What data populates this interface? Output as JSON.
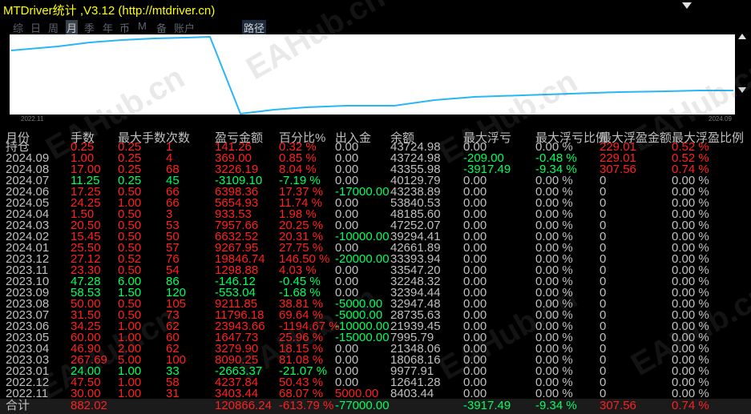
{
  "window": {
    "title": "MTDriver统计 ,V3.12 (http://mtdriver.cn)"
  },
  "tabs": [
    {
      "label": "综",
      "active": false
    },
    {
      "label": "日",
      "active": false
    },
    {
      "label": "周",
      "active": false
    },
    {
      "label": "月",
      "active": true
    },
    {
      "label": "季",
      "active": false
    },
    {
      "label": "年",
      "active": false
    },
    {
      "label": "币",
      "active": false
    },
    {
      "label": "M",
      "active": false
    },
    {
      "label": "备",
      "active": false
    },
    {
      "label": "账户",
      "active": false
    },
    {
      "label": "路径",
      "active": false
    }
  ],
  "chart": {
    "line_color": "#29b6f6",
    "start_label": "2022.11",
    "end_label": "2024.09"
  },
  "watermark": "EAHub.cn",
  "colors": {
    "red": "#ff2020",
    "green": "#00ff60",
    "gray": "#c0c0c0",
    "title": "#ffff00"
  },
  "columns": [
    "月份",
    "手数",
    "最大手数",
    "次数",
    "盈亏金额",
    "百分比%",
    "出入金",
    "余额",
    "最大浮亏",
    "最大浮亏比例",
    "最大浮盈金额",
    "最大浮盈比例"
  ],
  "rows": [
    [
      "持仓",
      "0.25",
      "0.25",
      "1",
      "141.26",
      "0.32 %",
      "0.00",
      "43724.98",
      "0.00",
      "0.00 %",
      "229.01",
      "0.52 %"
    ],
    [
      "2024.09",
      "1.00",
      "0.25",
      "4",
      "369.00",
      "0.85 %",
      "0.00",
      "43724.98",
      "-209.00",
      "-0.48 %",
      "229.01",
      "0.52 %"
    ],
    [
      "2024.08",
      "17.00",
      "0.25",
      "68",
      "3226.19",
      "8.04 %",
      "0.00",
      "43355.98",
      "-3917.49",
      "-9.34 %",
      "307.56",
      "0.74 %"
    ],
    [
      "2024.07",
      "11.25",
      "0.25",
      "45",
      "-3109.10",
      "-7.19 %",
      "0.00",
      "40129.79",
      "0.00",
      "0.00 %",
      "0",
      "0.00 %"
    ],
    [
      "2024.06",
      "17.25",
      "0.50",
      "66",
      "6398.36",
      "17.37 %",
      "-17000.00",
      "43238.89",
      "0.00",
      "0.00 %",
      "0",
      "0.00 %"
    ],
    [
      "2024.05",
      "24.25",
      "1.00",
      "66",
      "5654.93",
      "11.74 %",
      "0.00",
      "53840.53",
      "0.00",
      "0.00 %",
      "0",
      "0.00 %"
    ],
    [
      "2024.04",
      "1.50",
      "0.50",
      "3",
      "933.53",
      "1.98 %",
      "0.00",
      "48185.60",
      "0.00",
      "0.00 %",
      "0",
      "0.00 %"
    ],
    [
      "2024.03",
      "20.50",
      "0.50",
      "53",
      "7957.66",
      "20.25 %",
      "0.00",
      "47252.07",
      "0.00",
      "0.00 %",
      "0",
      "0.00 %"
    ],
    [
      "2024.02",
      "15.45",
      "0.50",
      "50",
      "6632.52",
      "20.31 %",
      "-10000.00",
      "39294.41",
      "0.00",
      "0.00 %",
      "0",
      "0.00 %"
    ],
    [
      "2024.01",
      "25.50",
      "0.50",
      "57",
      "9267.95",
      "27.75 %",
      "0.00",
      "42661.89",
      "0.00",
      "0.00 %",
      "0",
      "0.00 %"
    ],
    [
      "2023.12",
      "27.12",
      "0.52",
      "76",
      "19846.74",
      "146.50 %",
      "-20000.00",
      "33393.94",
      "0.00",
      "0.00 %",
      "0",
      "0.00 %"
    ],
    [
      "2023.11",
      "23.30",
      "0.50",
      "54",
      "1298.88",
      "4.03 %",
      "0.00",
      "33547.20",
      "0.00",
      "0.00 %",
      "0",
      "0.00 %"
    ],
    [
      "2023.10",
      "47.28",
      "6.00",
      "86",
      "-146.12",
      "-0.45 %",
      "0.00",
      "32248.32",
      "0.00",
      "0.00 %",
      "0",
      "0.00 %"
    ],
    [
      "2023.09",
      "58.53",
      "1.50",
      "120",
      "-553.04",
      "-1.68 %",
      "0.00",
      "32394.44",
      "0.00",
      "0.00 %",
      "0",
      "0.00 %"
    ],
    [
      "2023.08",
      "50.00",
      "0.50",
      "105",
      "9211.85",
      "38.81 %",
      "-5000.00",
      "32947.48",
      "0.00",
      "0.00 %",
      "0",
      "0.00 %"
    ],
    [
      "2023.07",
      "31.50",
      "0.50",
      "73",
      "11796.18",
      "69.64 %",
      "-5000.00",
      "28735.63",
      "0.00",
      "0.00 %",
      "0",
      "0.00 %"
    ],
    [
      "2023.06",
      "34.25",
      "1.00",
      "62",
      "23943.66",
      "-1194.67 %",
      "-10000.00",
      "21939.45",
      "0.00",
      "0.00 %",
      "0",
      "0.00 %"
    ],
    [
      "2023.05",
      "60.00",
      "1.00",
      "60",
      "1647.73",
      "25.96 %",
      "-15000.00",
      "7995.79",
      "0.00",
      "0.00 %",
      "0",
      "0.00 %"
    ],
    [
      "2023.04",
      "46.90",
      "2.00",
      "62",
      "3279.90",
      "18.15 %",
      "0.00",
      "21348.06",
      "0.00",
      "0.00 %",
      "0",
      "0.00 %"
    ],
    [
      "2023.03",
      "267.69",
      "5.00",
      "100",
      "8090.25",
      "81.08 %",
      "0.00",
      "18068.16",
      "0.00",
      "0.00 %",
      "0",
      "0.00 %"
    ],
    [
      "2023.01",
      "24.00",
      "1.00",
      "33",
      "-2663.37",
      "-21.07 %",
      "0.00",
      "9977.91",
      "0.00",
      "0.00 %",
      "0",
      "0.00 %"
    ],
    [
      "2022.12",
      "47.50",
      "1.00",
      "58",
      "4237.84",
      "50.43 %",
      "0.00",
      "12641.28",
      "0.00",
      "0.00 %",
      "0",
      "0.00 %"
    ],
    [
      "2022.11",
      "30.00",
      "1.00",
      "31",
      "3403.44",
      "68.07 %",
      "5000.00",
      "8403.44",
      "0.00",
      "0.00 %",
      "0",
      "0.00 %"
    ]
  ],
  "totals": [
    "合计",
    "882.02",
    "",
    "",
    "120866.24",
    "-613.79 %",
    "-77000.00",
    "",
    "-3917.49",
    "-9.34 %",
    "307.56",
    "0.74 %"
  ]
}
